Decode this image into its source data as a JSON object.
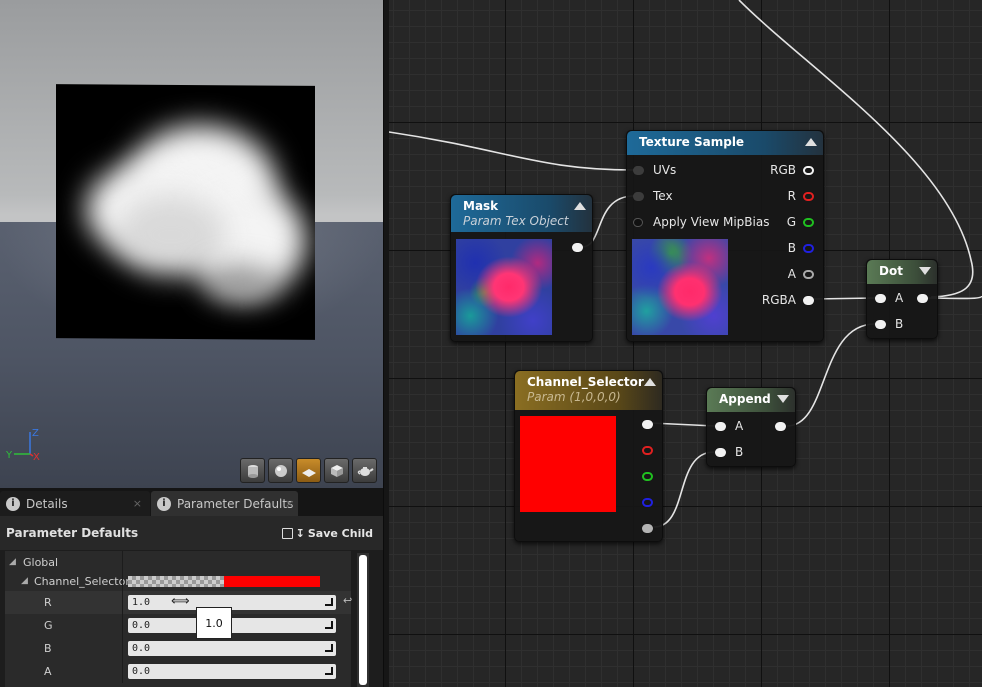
{
  "viewport": {
    "axis_labels": {
      "z": "Z",
      "y": "Y",
      "x": "X"
    },
    "toolbar": [
      "cylinder-icon",
      "sphere-icon",
      "plane-icon",
      "cube-icon",
      "teapot-icon"
    ],
    "active_tool": "plane-icon"
  },
  "details_panel": {
    "tabs": [
      {
        "label": "Details",
        "close": "×"
      },
      {
        "label": "Parameter Defaults",
        "close": "×"
      }
    ],
    "title": "Parameter Defaults",
    "save_child_label": "Save Child",
    "tree": {
      "group": "Global",
      "parameter": "Channel_Selector",
      "color_swatch": "#ff0000",
      "rows": [
        {
          "label": "R",
          "value": "1.0"
        },
        {
          "label": "G",
          "value": "0.0"
        },
        {
          "label": "B",
          "value": "0.0"
        },
        {
          "label": "A",
          "value": "0.0"
        }
      ]
    },
    "drag_tooltip": "1.0"
  },
  "graph": {
    "texture_sample": {
      "title": "Texture Sample",
      "inputs": [
        "UVs",
        "Tex",
        "Apply View MipBias"
      ],
      "outputs": [
        "RGB",
        "R",
        "G",
        "B",
        "A",
        "RGBA"
      ]
    },
    "mask": {
      "title": "Mask",
      "subtitle": "Param Tex Object"
    },
    "channel_selector": {
      "title": "Channel_Selector",
      "subtitle": "Param (1,0,0,0)",
      "preview_color": "#ff0000"
    },
    "append": {
      "title": "Append",
      "inputs": [
        "A",
        "B"
      ]
    },
    "dot": {
      "title": "Dot",
      "inputs": [
        "A",
        "B"
      ]
    },
    "colors": {
      "texture_header": "#1f5c85",
      "mask_header": "#1f5c85",
      "param_header": "#6b5a24",
      "math_header": "#4a5f45",
      "wire": "#e8e8e8",
      "pin_r": "#e02020",
      "pin_g": "#20c020",
      "pin_b": "#2020e0"
    }
  }
}
